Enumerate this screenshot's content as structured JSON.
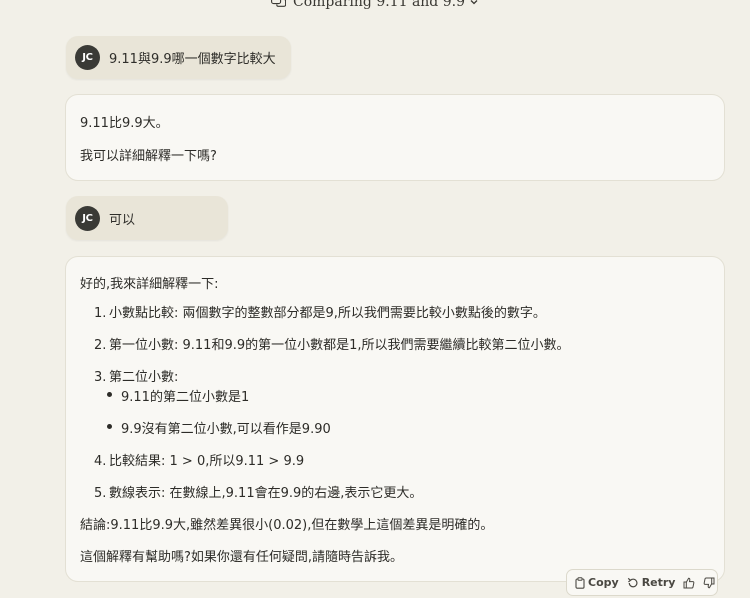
{
  "header": {
    "title": "Comparing 9.11 and 9.9"
  },
  "user": {
    "initials": "JC"
  },
  "messages": {
    "user_1": "9.11與9.9哪一個數字比較大",
    "ai_1": {
      "line_1": "9.11比9.9大。",
      "line_2": "我可以詳細解釋一下嗎?"
    },
    "user_2": "可以",
    "ai_2": {
      "intro": "好的,我來詳細解釋一下:",
      "items": [
        {
          "num": "1.",
          "text": "小數點比較: 兩個數字的整數部分都是9,所以我們需要比較小數點後的數字。"
        },
        {
          "num": "2.",
          "text": "第一位小數: 9.11和9.9的第一位小數都是1,所以我們需要繼續比較第二位小數。"
        },
        {
          "num": "3.",
          "text": "第二位小數:"
        },
        {
          "num": "4.",
          "text": "比較結果: 1 > 0,所以9.11 > 9.9"
        },
        {
          "num": "5.",
          "text": "數線表示: 在數線上,9.11會在9.9的右邊,表示它更大。"
        }
      ],
      "bullets": [
        "9.11的第二位小數是1",
        "9.9沒有第二位小數,可以看作是9.90"
      ],
      "conclusion": "結論:9.11比9.9大,雖然差異很小(0.02),但在數學上這個差異是明確的。",
      "closing": "這個解釋有幫助嗎?如果你還有任何疑問,請隨時告訴我。"
    }
  },
  "actions": {
    "copy": "Copy",
    "retry": "Retry"
  },
  "icons": [
    "chat-bubbles-icon",
    "chevron-down-icon",
    "clipboard-icon",
    "retry-icon",
    "thumbs-up-icon",
    "thumbs-down-icon"
  ],
  "colors": {
    "background": "#f2f0e8",
    "user_bubble": "#e9e5d8",
    "ai_bubble": "#f9f8f4",
    "avatar": "#3a3a36"
  }
}
